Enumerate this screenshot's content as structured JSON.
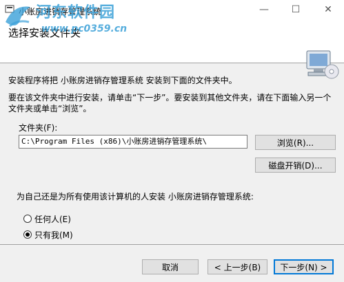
{
  "window": {
    "title": "小账房进销存管理系统",
    "min_glyph": "—",
    "max_glyph": "☐",
    "close_glyph": "✕"
  },
  "header": {
    "title": "选择安装文件夹",
    "watermark_text": "河东软件园",
    "watermark_url": "www.pc0359.cn"
  },
  "body": {
    "line1": "安装程序将把 小账房进销存管理系统 安装到下面的文件夹中。",
    "line2": "要在该文件夹中进行安装，请单击“下一步”。要安装到其他文件夹，请在下面输入另一个文件夹或单击“浏览”。",
    "folder_label": "文件夹(F):",
    "folder_path": "C:\\Program Files (x86)\\小账房进销存管理系统\\",
    "browse_label": "浏览(R)...",
    "disk_cost_label": "磁盘开销(D)...",
    "question": "为自己还是为所有使用该计算机的人安装 小账房进销存管理系统:",
    "options": [
      {
        "label": "任何人(E)",
        "checked": false
      },
      {
        "label": "只有我(M)",
        "checked": true
      }
    ]
  },
  "footer": {
    "cancel_label": "取消",
    "back_label": "< 上一步(B)",
    "next_label": "下一步(N) >"
  },
  "colors": {
    "accent": "#0078d7",
    "watermark": "#3aa0d8"
  }
}
